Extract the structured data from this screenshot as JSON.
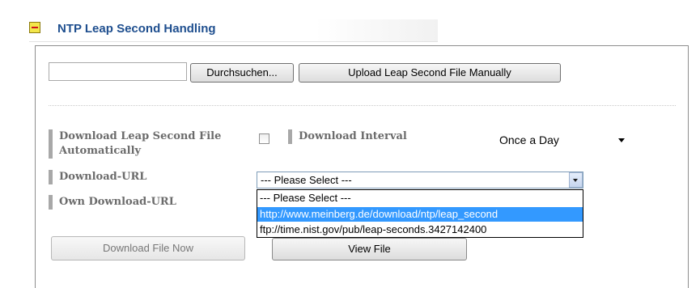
{
  "section": {
    "title": "NTP Leap Second Handling",
    "toggle_icon": "collapse-minus-icon"
  },
  "upload": {
    "file_value": "",
    "browse_label": "Durchsuchen...",
    "upload_label": "Upload Leap Second File Manually"
  },
  "auto": {
    "label": "Download Leap Second File Automatically",
    "checked": false
  },
  "interval": {
    "label": "Download Interval",
    "selected": "Once a Day"
  },
  "url": {
    "label": "Download-URL",
    "selected": "--- Please Select ---",
    "options": [
      "--- Please Select ---",
      "http://www.meinberg.de/download/ntp/leap_second",
      "ftp://time.nist.gov/pub/leap-seconds.3427142400"
    ],
    "highlighted_index": 1
  },
  "own_url": {
    "label": "Own Download-URL"
  },
  "actions": {
    "download_now_label": "Download File Now",
    "view_file_label": "View File"
  },
  "colors": {
    "title": "#1f4f8f",
    "highlight": "#3399ff",
    "label_bar": "#a8a8a8"
  }
}
